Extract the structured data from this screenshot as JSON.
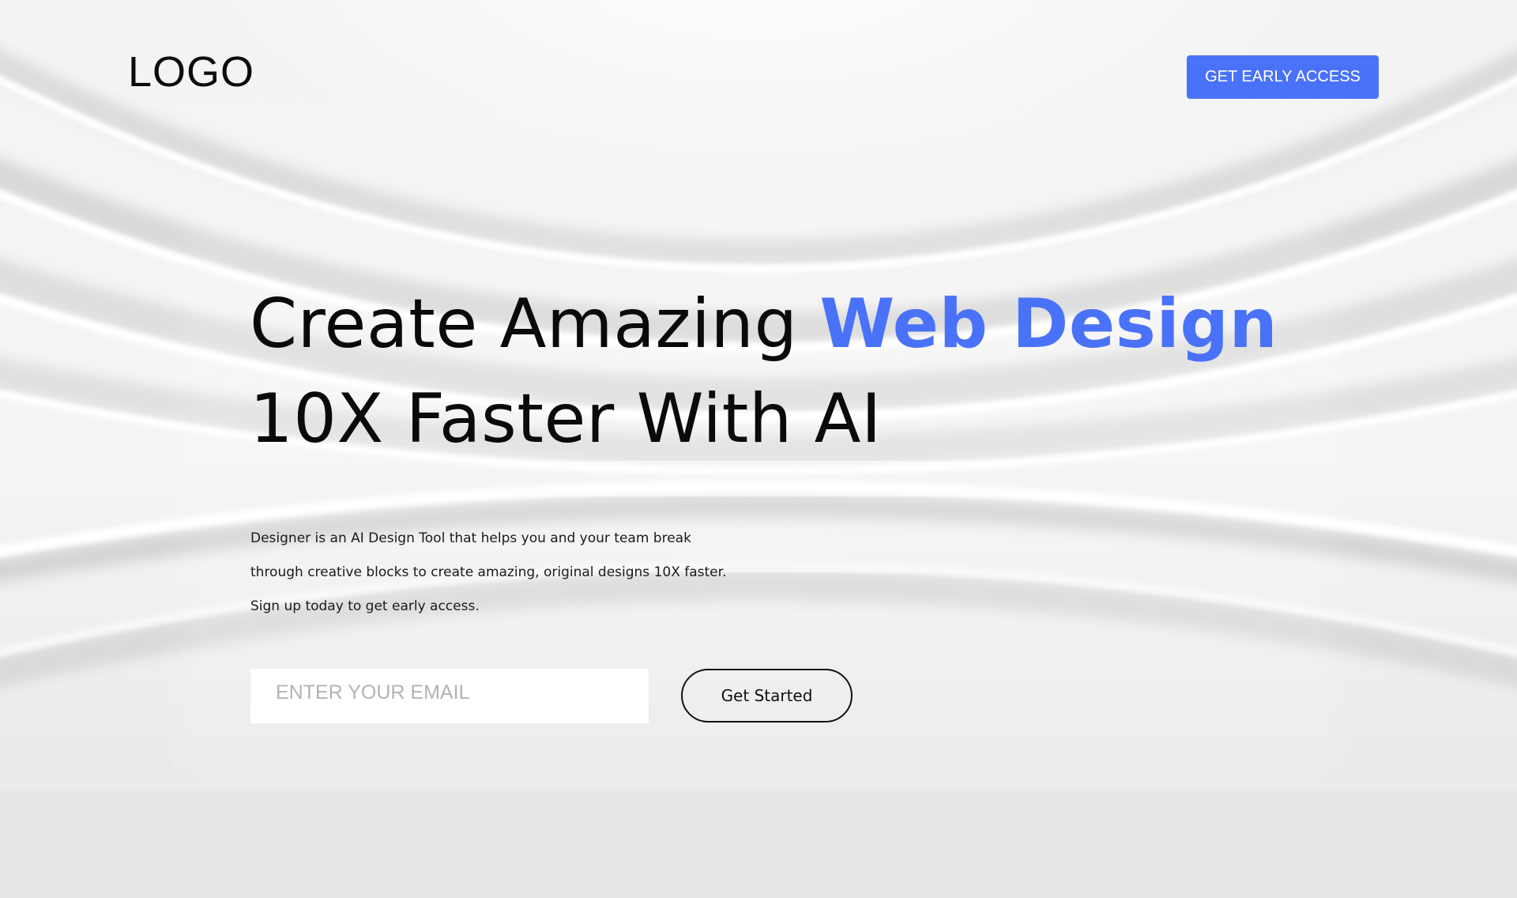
{
  "header": {
    "logo_text": "LOGO",
    "cta_label": "GET EARLY ACCESS"
  },
  "hero": {
    "headline_part1": "Create Amazing ",
    "headline_accent": "Web Design",
    "headline_line2": "10X Faster With AI",
    "description_lines": [
      "Designer is an AI Design Tool that helps you and your team break",
      "through creative blocks to create amazing, original designs 10X faster.",
      "Sign up today to get early access."
    ]
  },
  "signup": {
    "email_placeholder": "ENTER YOUR EMAIL",
    "email_value": "",
    "submit_label": "Get Started"
  },
  "colors": {
    "accent": "#4a72f8",
    "text": "#0a0a0a",
    "background": "#ececec"
  }
}
